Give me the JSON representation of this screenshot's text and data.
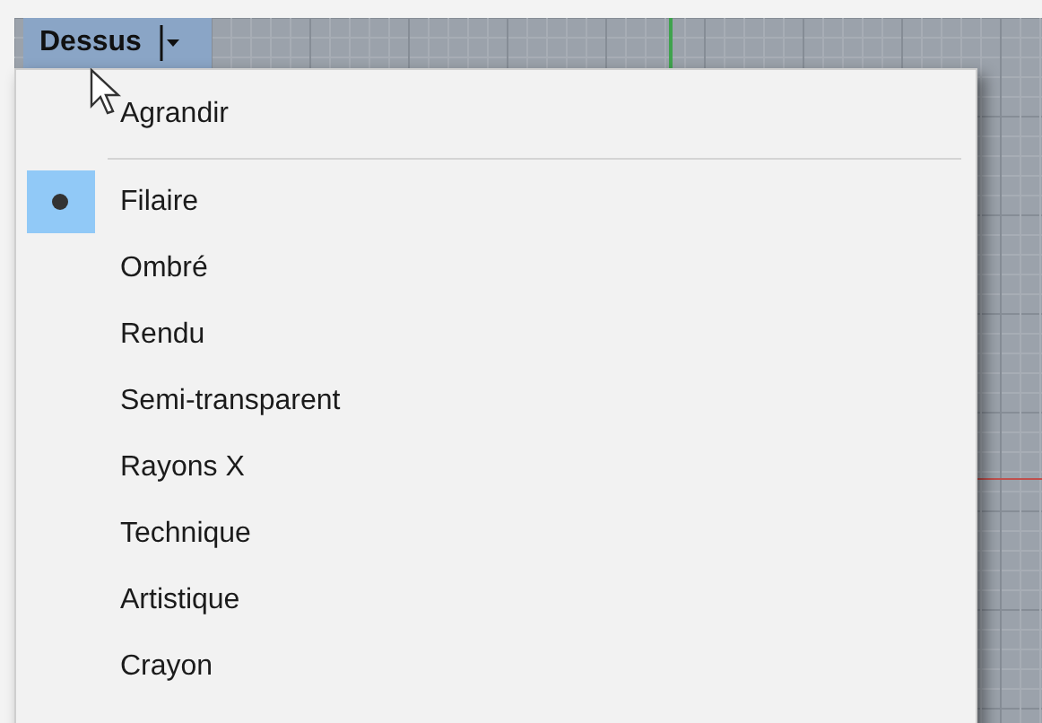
{
  "viewport": {
    "title": "Dessus"
  },
  "menu": {
    "items": [
      {
        "kind": "command",
        "label": "Agrandir"
      },
      {
        "kind": "separator"
      },
      {
        "kind": "radio",
        "label": "Filaire",
        "selected": true
      },
      {
        "kind": "radio",
        "label": "Ombré",
        "selected": false
      },
      {
        "kind": "radio",
        "label": "Rendu",
        "selected": false
      },
      {
        "kind": "radio",
        "label": "Semi-transparent",
        "selected": false
      },
      {
        "kind": "radio",
        "label": "Rayons X",
        "selected": false
      },
      {
        "kind": "radio",
        "label": "Technique",
        "selected": false
      },
      {
        "kind": "radio",
        "label": "Artistique",
        "selected": false
      },
      {
        "kind": "radio",
        "label": "Crayon",
        "selected": false
      }
    ]
  }
}
